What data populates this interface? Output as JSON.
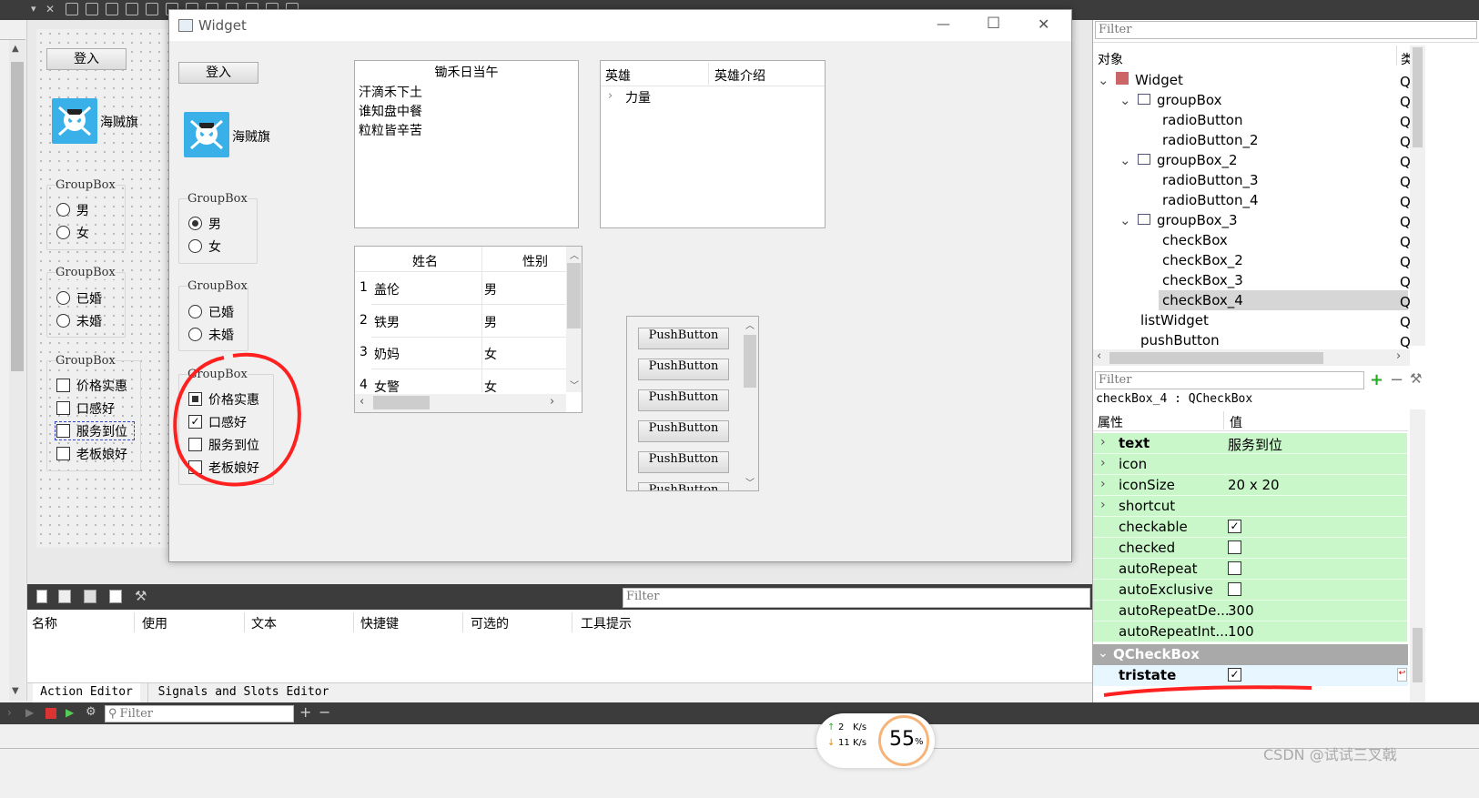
{
  "designer": {
    "form": {
      "login_button": "登入",
      "flag_label": "海贼旗",
      "gb1": {
        "title": "GroupBox",
        "options": [
          "男",
          "女"
        ]
      },
      "gb2": {
        "title": "GroupBox",
        "options": [
          "已婚",
          "未婚"
        ]
      },
      "gb3": {
        "title": "GroupBox",
        "options": [
          "价格实惠",
          "口感好",
          "服务到位",
          "老板娘好"
        ]
      }
    }
  },
  "widget_window": {
    "title": "Widget",
    "controls": {
      "minimize": "—",
      "maximize": "☐",
      "close": "✕"
    },
    "login_button": "登入",
    "flag_label": "海贼旗",
    "gb1": {
      "title": "GroupBox",
      "options": [
        "男",
        "女"
      ],
      "selected": "男"
    },
    "gb2": {
      "title": "GroupBox",
      "options": [
        "已婚",
        "未婚"
      ]
    },
    "gb3": {
      "title": "GroupBox",
      "options": [
        {
          "label": "价格实惠",
          "state": "partial"
        },
        {
          "label": "口感好",
          "state": "checked"
        },
        {
          "label": "服务到位",
          "state": "unchecked"
        },
        {
          "label": "老板娘好",
          "state": "unchecked"
        }
      ]
    },
    "poem_list": {
      "header": "锄禾日当午",
      "lines": [
        "汗滴禾下土",
        "谁知盘中餐",
        "粒粒皆辛苦"
      ]
    },
    "tree_widget": {
      "headers": [
        "英雄",
        "英雄介绍"
      ],
      "item": "力量"
    },
    "table": {
      "headers": [
        "姓名",
        "性别"
      ],
      "rows": [
        {
          "num": "1",
          "name": "盖伦",
          "sex": "男"
        },
        {
          "num": "2",
          "name": "铁男",
          "sex": "男"
        },
        {
          "num": "3",
          "name": "奶妈",
          "sex": "女"
        },
        {
          "num": "4",
          "name": "女警",
          "sex": "女"
        }
      ]
    },
    "push_buttons": [
      "PushButton",
      "PushButton",
      "PushButton",
      "PushButton",
      "PushButton",
      "PushButton"
    ]
  },
  "object_inspector": {
    "filter_placeholder": "Filter",
    "header": {
      "col1": "对象",
      "col2": "类"
    },
    "tree": [
      {
        "label": "Widget",
        "level": 0,
        "expand": true,
        "cls": "Q"
      },
      {
        "label": "groupBox",
        "level": 1,
        "expand": true,
        "cls": "Q"
      },
      {
        "label": "radioButton",
        "level": 2,
        "cls": "Q"
      },
      {
        "label": "radioButton_2",
        "level": 2,
        "cls": "Q"
      },
      {
        "label": "groupBox_2",
        "level": 1,
        "expand": true,
        "cls": "Q"
      },
      {
        "label": "radioButton_3",
        "level": 2,
        "cls": "Q"
      },
      {
        "label": "radioButton_4",
        "level": 2,
        "cls": "Q"
      },
      {
        "label": "groupBox_3",
        "level": 1,
        "expand": true,
        "cls": "Q"
      },
      {
        "label": "checkBox",
        "level": 2,
        "cls": "Q"
      },
      {
        "label": "checkBox_2",
        "level": 2,
        "cls": "Q"
      },
      {
        "label": "checkBox_3",
        "level": 2,
        "cls": "Q"
      },
      {
        "label": "checkBox_4",
        "level": 2,
        "cls": "Q",
        "selected": true
      },
      {
        "label": "listWidget",
        "level": 1,
        "cls": "Q"
      },
      {
        "label": "pushButton",
        "level": 1,
        "cls": "Q"
      }
    ]
  },
  "property_editor": {
    "filter_placeholder": "Filter",
    "object_label": "checkBox_4 : QCheckBox",
    "header": {
      "name": "属性",
      "value": "值"
    },
    "rows": [
      {
        "name": "text",
        "value": "服务到位",
        "bold": true,
        "expand": true
      },
      {
        "name": "icon",
        "value": "",
        "expand": true
      },
      {
        "name": "iconSize",
        "value": "20 x 20",
        "expand": true
      },
      {
        "name": "shortcut",
        "value": "",
        "expand": true
      },
      {
        "name": "checkable",
        "checkbox": true,
        "checked": true
      },
      {
        "name": "checked",
        "checkbox": true,
        "checked": false
      },
      {
        "name": "autoRepeat",
        "checkbox": true,
        "checked": false
      },
      {
        "name": "autoExclusive",
        "checkbox": true,
        "checked": false
      },
      {
        "name": "autoRepeatDe...",
        "value": "300"
      },
      {
        "name": "autoRepeatInt...",
        "value": "100"
      }
    ],
    "section": "QCheckBox",
    "tristate": {
      "name": "tristate",
      "checked": true
    }
  },
  "action_editor": {
    "filter_placeholder": "Filter",
    "columns": [
      "名称",
      "使用",
      "文本",
      "快捷键",
      "可选的",
      "工具提示"
    ],
    "tabs": [
      "Action Editor",
      "Signals and Slots Editor"
    ]
  },
  "statusbar": {
    "filter_placeholder": "Filter"
  },
  "net_widget": {
    "up": "2",
    "down": "11",
    "unit": "K/s",
    "percent": "55",
    "percent_sign": "%"
  },
  "watermark": "CSDN @试试三叉戟",
  "colors": {
    "property_green": "#c9f7c9",
    "section_grey": "#a9a9a9",
    "annotation_red": "#ff2020"
  }
}
